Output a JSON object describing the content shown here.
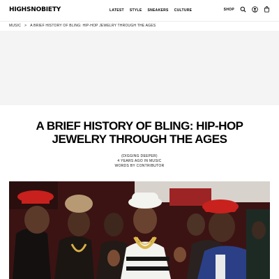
{
  "header": {
    "logo": "HIGHSNOBIETY",
    "nav": [
      "LATEST",
      "STYLE",
      "SNEAKERS",
      "CULTURE"
    ],
    "shop_label": "SHOP",
    "icons": [
      "search-icon",
      "account-icon",
      "cart-icon"
    ]
  },
  "breadcrumb": {
    "section": "MUSIC",
    "separator": ">",
    "current": "A BRIEF HISTORY OF BLING: HIP-HOP JEWELRY THROUGH THE AGES"
  },
  "article": {
    "title": "A BRIEF HISTORY OF BLING: HIP-HOP JEWELRY THROUGH THE AGES",
    "series": "(DIGGING DEEPER)",
    "date_line": "4 YEARS AGO IN MUSIC",
    "byline": "WORDS BY CONTRIBUTOR"
  },
  "colors": {
    "accent": "#000000",
    "background": "#ffffff",
    "placeholder": "#f4f4f4"
  }
}
